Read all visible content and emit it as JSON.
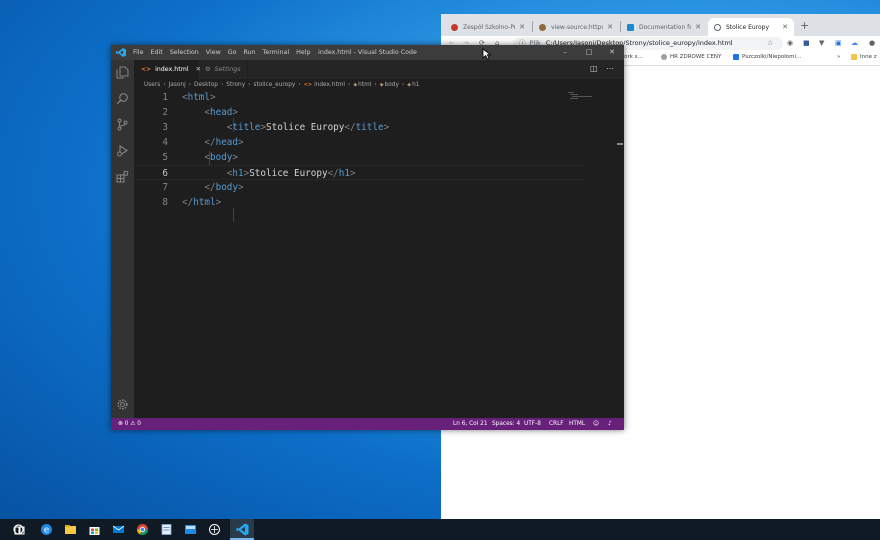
{
  "chrome": {
    "tabs": [
      {
        "label": "Zespół Szkolno-Przedszkolny"
      },
      {
        "label": "view-source:https://"
      },
      {
        "label": "Documentation for"
      },
      {
        "label": "Stolice Europy"
      }
    ],
    "new_tab": "+",
    "address": {
      "prefix": "Plik",
      "url": "C:/Users/Jasonj/Desktop/Strony/stolice_europy/index.html"
    },
    "bookmarks": [
      {
        "label": "Work s..."
      },
      {
        "label": "HR ZDROWE CENY"
      },
      {
        "label": "Pszczolki/Niepołomi..."
      },
      {
        "label": "Inne z"
      }
    ],
    "bookmarks_more": "»"
  },
  "vscode": {
    "menu": [
      "File",
      "Edit",
      "Selection",
      "View",
      "Go",
      "Run",
      "Terminal",
      "Help"
    ],
    "window_title": "index.html - Visual Studio Code",
    "controls": {
      "minimize": "–",
      "maximize": "□",
      "close": "✕"
    },
    "tabs": [
      {
        "label": "index.html",
        "active": true,
        "icon": "html-file-icon",
        "close": "✕"
      },
      {
        "label": "Settings",
        "active": false,
        "icon": "gear-icon"
      }
    ],
    "breadcrumb": [
      "Users",
      "Jasonj",
      "Desktop",
      "Strony",
      "stolice_europy",
      "index.html",
      "html",
      "body",
      "h1"
    ],
    "code": [
      {
        "n": "1",
        "text": "<html>"
      },
      {
        "n": "2",
        "text": "    <head>"
      },
      {
        "n": "3",
        "text": "        <title>Stolice Europy</title>"
      },
      {
        "n": "4",
        "text": "    </head>"
      },
      {
        "n": "5",
        "text": "    <body>"
      },
      {
        "n": "6",
        "text": "        <h1>Stolice Europy</h1>"
      },
      {
        "n": "7",
        "text": "    </body>"
      },
      {
        "n": "8",
        "text": "</html>"
      }
    ],
    "status": {
      "errors": "⊗ 0 ⚠ 0",
      "position": "Ln 6, Col 21",
      "spaces": "Spaces: 4",
      "encoding": "UTF-8",
      "eol": "CRLF",
      "language": "HTML"
    },
    "colors": {
      "status_bar": "#68217a",
      "tag": "#569cd6",
      "bracket": "#808080"
    }
  }
}
